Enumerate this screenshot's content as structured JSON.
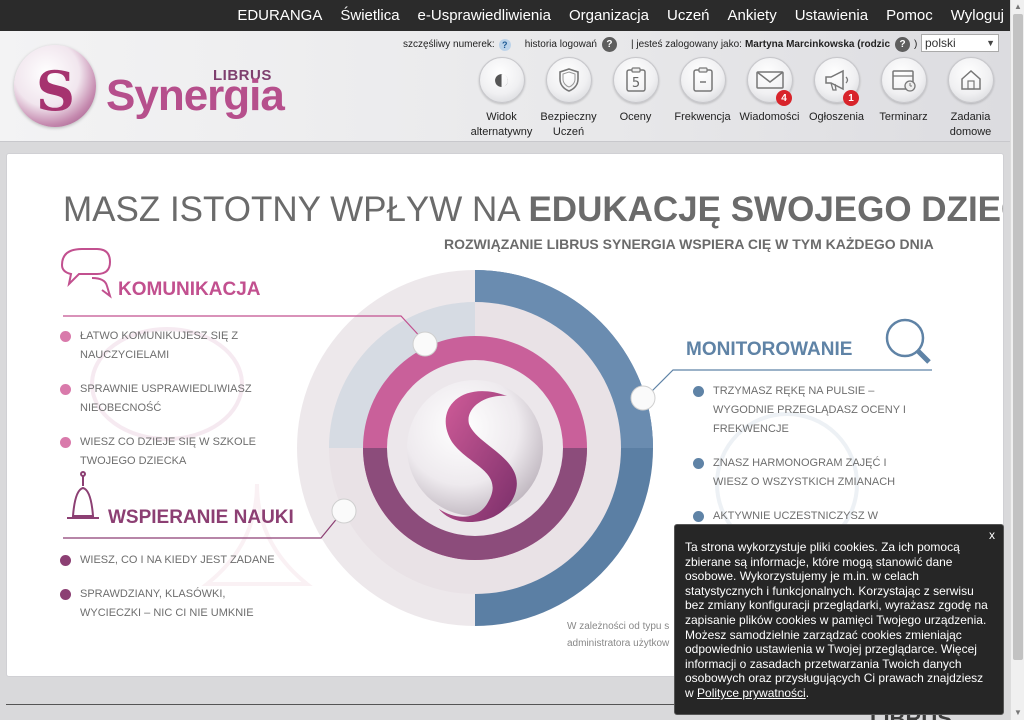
{
  "topmenu": [
    "EDURANGA",
    "Świetlica",
    "e-Usprawiedliwienia",
    "Organizacja",
    "Uczeń",
    "Ankiety",
    "Ustawienia",
    "Pomoc",
    "Wyloguj"
  ],
  "logo": {
    "brand_top": "LIBRUS",
    "brand_main": "Synergia"
  },
  "infobar": {
    "lucky_number_label": "szczęśliwy numerek:",
    "help_mark": "?",
    "login_history": "historia logowań",
    "logged_in_prefix": "| jesteś zalogowany jako:",
    "user_name": "Martyna Marcinkowska (rodzic",
    "user_suffix": ")",
    "language": "polski"
  },
  "nav": [
    {
      "label": "Widok alternatywny",
      "icon": "contrast-icon",
      "glyph": "◐",
      "badge": ""
    },
    {
      "label": "Bezpieczny Uczeń",
      "icon": "shield-icon",
      "glyph": "⛉",
      "badge": ""
    },
    {
      "label": "Oceny",
      "icon": "grade-icon",
      "glyph": "5",
      "badge": ""
    },
    {
      "label": "Frekwencja",
      "icon": "clipboard-icon",
      "glyph": "▯",
      "badge": ""
    },
    {
      "label": "Wiadomości",
      "icon": "envelope-icon",
      "glyph": "✉",
      "badge": "4"
    },
    {
      "label": "Ogłoszenia",
      "icon": "megaphone-icon",
      "glyph": "📢",
      "badge": "1"
    },
    {
      "label": "Terminarz",
      "icon": "calendar-icon",
      "glyph": "▦",
      "badge": ""
    },
    {
      "label": "Zadania domowe",
      "icon": "house-icon",
      "glyph": "⌂",
      "badge": ""
    }
  ],
  "hero": {
    "title_light": "MASZ ISTOTNY WPŁYW NA",
    "title_bold": "EDUKACJĘ SWOJEGO DZIECKA",
    "subtitle": "ROZWIĄZANIE LIBRUS SYNERGIA WSPIERA CIĘ W TYM KAŻDEGO DNIA"
  },
  "sections": {
    "komunikacja": {
      "title": "KOMUNIKACJA",
      "items": [
        "ŁATWO KOMUNIKUJESZ SIĘ Z NAUCZYCIELAMI",
        "SPRAWNIE USPRAWIEDLIWIASZ NIEOBECNOŚĆ",
        "WIESZ CO DZIEJE SIĘ W SZKOLE TWOJEGO DZIECKA"
      ]
    },
    "wspieranie": {
      "title": "WSPIERANIE NAUKI",
      "items": [
        "WIESZ, CO I NA KIEDY JEST ZADANE",
        "SPRAWDZIANY, KLASÓWKI, WYCIECZKI – NIC CI NIE UMKNIE"
      ]
    },
    "monitorowanie": {
      "title": "MONITOROWANIE",
      "items": [
        "TRZYMASZ RĘKĘ NA PULSIE – WYGODNIE PRZEGLĄDASZ OCENY I FREKWENCJE",
        "ZNASZ HARMONOGRAM ZAJĘĆ I WIESZ O WSZYSTKICH ZMIANACH",
        "AKTYWNIE UCZESTNICZYSZ W SUKCESACH SWOJEGO DZIECKA I WSPIERASZ JE WTEDY, KIEDY TEGO"
      ]
    }
  },
  "footnote": "W zależności od typu s administratora użytkow",
  "footer_logo": "LIBRUS",
  "cookie": {
    "close": "x",
    "text": "Ta strona wykorzystuje pliki cookies. Za ich pomocą zbierane są informacje, które mogą stanowić dane osobowe. Wykorzystujemy je m.in. w celach statystycznych i funkcjonalnych. Korzystając z serwisu bez zmiany konfiguracji przeglądarki, wyrażasz zgodę na zapisanie plików cookies w pamięci Twojego urządzenia. Możesz samodzielnie zarządzać cookies zmieniając odpowiednio ustawienia w Twojej przeglądarce. Więcej informacji o zasadach przetwarzania Twoich danych osobowych oraz przysługujących Ci prawach znajdziesz w",
    "link": "Polityce prywatności",
    "end": "."
  },
  "colors": {
    "pink": "#c2508f",
    "plum": "#8c3f73",
    "steel": "#5f83a6",
    "title_gray": "#6b6b6b"
  }
}
